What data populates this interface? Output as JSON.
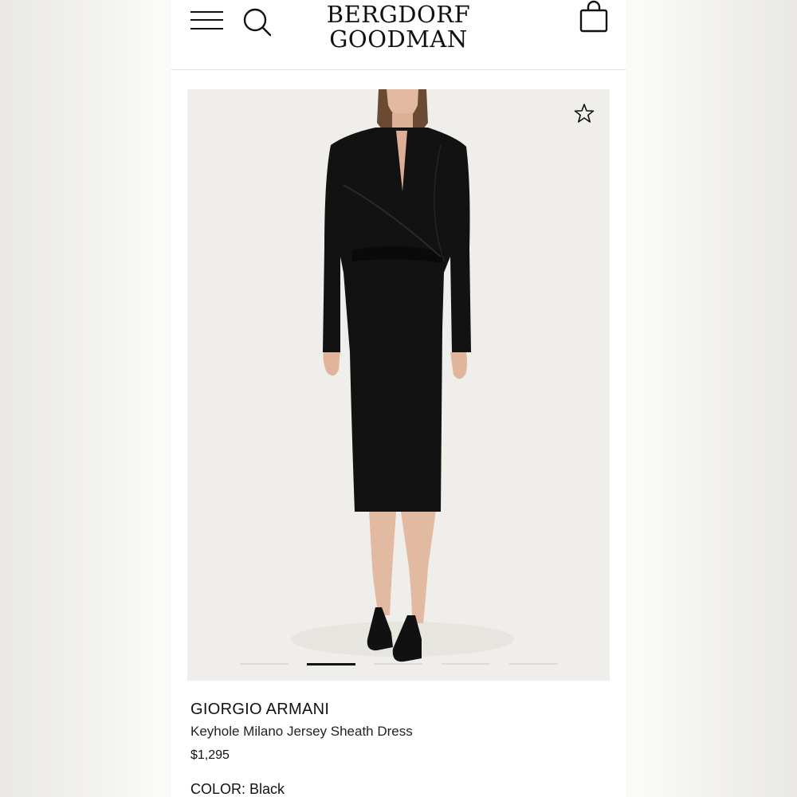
{
  "header": {
    "logo_line1": "BERGDORF",
    "logo_line2": "GOODMAN",
    "icons": {
      "menu": "hamburger-icon",
      "search": "search-icon",
      "bag": "shopping-bag-icon"
    }
  },
  "gallery": {
    "favorite_icon": "star-outline-icon",
    "image_count": 5,
    "active_index": 1,
    "background": "#efeeea"
  },
  "product": {
    "brand": "GIORGIO ARMANI",
    "name": "Keyhole Milano Jersey Sheath Dress",
    "price": "$1,295",
    "color_label": "COLOR:",
    "color_value": "Black"
  },
  "colors": {
    "accent": "#111111",
    "divider": "#e3e3e3"
  }
}
